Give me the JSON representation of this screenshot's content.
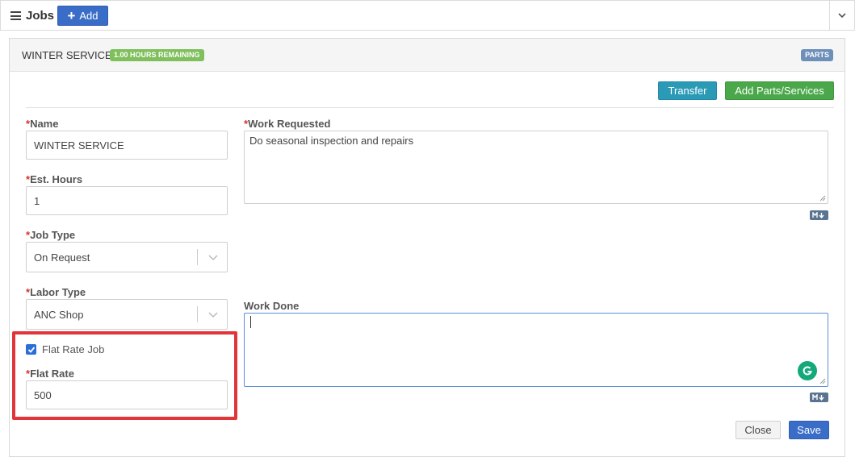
{
  "header": {
    "title": "Jobs",
    "add_label": "Add"
  },
  "panel": {
    "title": "WINTER SERVICE",
    "hours_badge": "1.00 HOURS REMAINING",
    "parts_badge": "PARTS",
    "transfer_label": "Transfer",
    "add_parts_label": "Add Parts/Services"
  },
  "form": {
    "required_marker": "*",
    "name_label": "Name",
    "name_value": "WINTER SERVICE",
    "est_hours_label": "Est. Hours",
    "est_hours_value": "1",
    "job_type_label": "Job Type",
    "job_type_value": "On Request",
    "labor_type_label": "Labor Type",
    "labor_type_value": "ANC Shop",
    "flat_rate_job_label": "Flat Rate Job",
    "flat_rate_job_checked": true,
    "flat_rate_label": "Flat Rate",
    "flat_rate_value": "500",
    "work_requested_label": "Work Requested",
    "work_requested_value": "Do seasonal inspection and repairs",
    "work_done_label": "Work Done",
    "work_done_value": ""
  },
  "footer": {
    "close_label": "Close",
    "save_label": "Save"
  },
  "colors": {
    "primary": "#3a6dc7",
    "info": "#2a9ab6",
    "success": "#4aa84a",
    "required": "#d9312b",
    "highlight": "#e0363a",
    "badge_green": "#7fbf5c",
    "badge_blue": "#6d8fba"
  },
  "icons": {
    "menu": "hamburger-icon",
    "add": "plus-icon",
    "collapse": "chevron-down-icon",
    "markdown": "markdown-icon",
    "grammarly": "grammarly-icon"
  }
}
